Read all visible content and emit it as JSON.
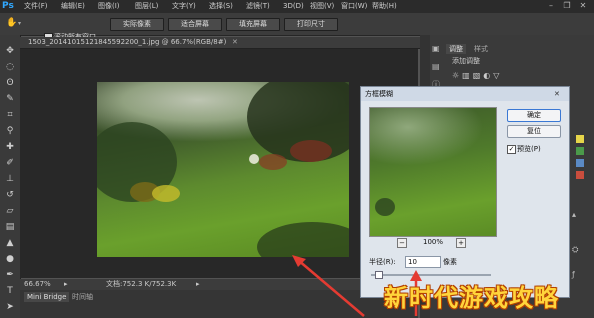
{
  "app": {
    "logo": "Ps"
  },
  "menubar": {
    "items": [
      "文件(F)",
      "编辑(E)",
      "图像(I)",
      "图层(L)",
      "文字(Y)",
      "选择(S)",
      "滤镜(T)",
      "3D(D)",
      "视图(V)",
      "窗口(W)",
      "帮助(H)"
    ]
  },
  "optionsbar": {
    "scroll_all_label": "滚动所有窗口",
    "btn_actual": "实际像素",
    "btn_fit": "适合屏幕",
    "btn_fill": "填充屏幕",
    "btn_print": "打印尺寸"
  },
  "document": {
    "tab_title": "1503_20141015121845592200_1.jpg @ 66.7%(RGB/8#)",
    "zoom": "66.67%",
    "doc_info": "文档:752.3 K/752.3K"
  },
  "bottom_tabs": [
    "Mini Bridge",
    "时间轴"
  ],
  "right_panel": {
    "tabs": [
      "调整",
      "样式"
    ],
    "add_adjust": "添加调整"
  },
  "dialog": {
    "title": "方框模糊",
    "ok": "确定",
    "reset": "复位",
    "preview_label": "预览(P)",
    "zoom": "100%",
    "radius_label": "半径(R):",
    "radius_value": "10",
    "radius_unit": "像素"
  },
  "watermark": "新时代游戏攻略",
  "colors": {
    "arrow": "#e43b32",
    "accent": "#31a8ff",
    "watermark_fill": "#ffd43b"
  }
}
